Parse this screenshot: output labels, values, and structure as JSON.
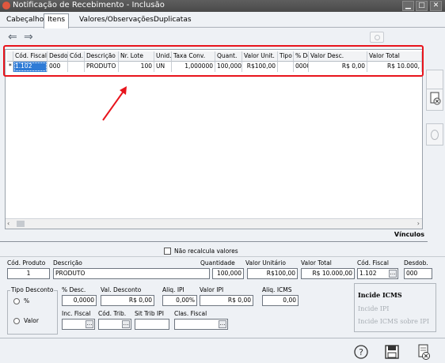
{
  "window": {
    "title": "Notificação de Recebimento - Inclusão",
    "min_label": "▁",
    "max_label": "□",
    "close_label": "✕"
  },
  "tabs": [
    "Cabeçalho",
    "Itens",
    "Valores/Observações",
    "Duplicatas"
  ],
  "nav": {
    "back": "⇐",
    "forward": "⇒"
  },
  "grid": {
    "columns": [
      "Cód. Fiscal",
      "Desdob.",
      "Cód.",
      "Descrição",
      "Nr. Lote",
      "Unid.",
      "Taxa Conv.",
      "Quant.",
      "Valor Unit.",
      "Tipo",
      "% De",
      "Valor Desc.",
      "Valor Total"
    ],
    "row_marker": "*",
    "row": [
      "1.102",
      "000",
      "",
      "PRODUTO",
      "100",
      "UN",
      "1,000000",
      "100,000",
      "R$100,00",
      "",
      "0000",
      "R$ 0,00",
      "R$ 10.000,"
    ]
  },
  "vinculos_label": "Vínculos",
  "nao_recalcula_label": "Não recalcula valores",
  "fields": {
    "cod_produto": {
      "label": "Cód. Produto",
      "value": "1"
    },
    "descricao": {
      "label": "Descrição",
      "value": "PRODUTO"
    },
    "quantidade": {
      "label": "Quantidade",
      "value": "100,000"
    },
    "valor_unitario": {
      "label": "Valor Unitário",
      "value": "R$100,00"
    },
    "valor_total": {
      "label": "Valor Total",
      "value": "R$ 10.000,00"
    },
    "cod_fiscal": {
      "label": "Cód. Fiscal",
      "value": "1.102"
    },
    "desdob": {
      "label": "Desdob.",
      "value": "000"
    },
    "tipo_desconto": {
      "label": "Tipo Desconto",
      "percent": "%",
      "valor": "Valor"
    },
    "pct_desc": {
      "label": "% Desc.",
      "value": "0,0000"
    },
    "val_desconto": {
      "label": "Val. Desconto",
      "value": "R$ 0,00"
    },
    "aliq_ipi": {
      "label": "Aliq. IPI",
      "value": "0,00%"
    },
    "valor_ipi": {
      "label": "Valor IPI",
      "value": "R$ 0,00"
    },
    "aliq_icms": {
      "label": "Aliq. ICMS",
      "value": "0,00"
    },
    "inc_fiscal": {
      "label": "Inc. Fiscal",
      "value": ""
    },
    "cod_trib": {
      "label": "Cód. Trib.",
      "value": ""
    },
    "sit_trib_ipi": {
      "label": "Sit Trib IPI",
      "value": ""
    },
    "clas_fiscal": {
      "label": "Clas. Fiscal",
      "value": ""
    }
  },
  "incide": {
    "icms": "Incide ICMS",
    "ipi": "Incide IPI",
    "icms_sobre_ipi": "Incide ICMS sobre IPI"
  },
  "colors": {
    "highlight": "#e8141c",
    "selected": "#2f7bd6"
  }
}
